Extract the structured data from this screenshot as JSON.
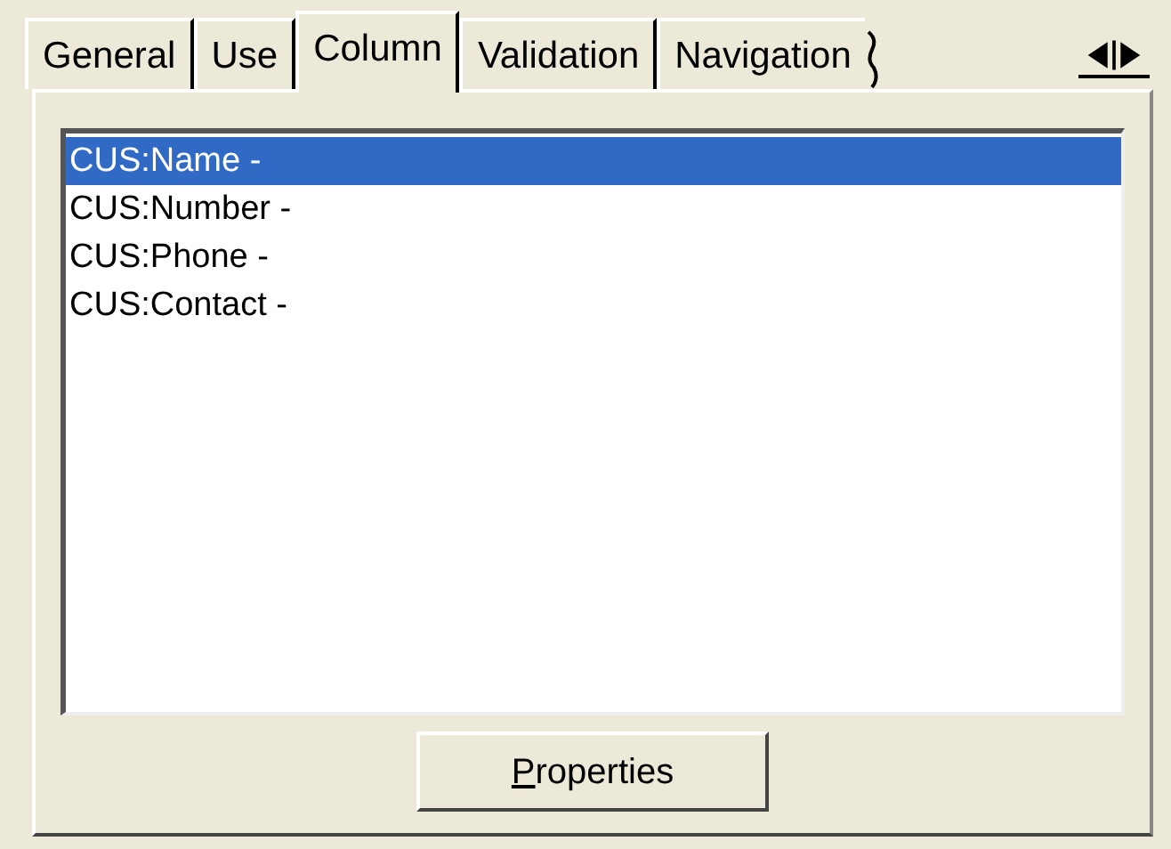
{
  "tabs": [
    {
      "label": "General",
      "selected": false
    },
    {
      "label": "Use",
      "selected": false
    },
    {
      "label": "Column",
      "selected": true
    },
    {
      "label": "Validation",
      "selected": false
    },
    {
      "label": "Navigation",
      "selected": false
    }
  ],
  "list": [
    {
      "label": "CUS:Name -",
      "selected": true
    },
    {
      "label": "CUS:Number -",
      "selected": false
    },
    {
      "label": "CUS:Phone -",
      "selected": false
    },
    {
      "label": "CUS:Contact -",
      "selected": false
    }
  ],
  "button": "Properties"
}
